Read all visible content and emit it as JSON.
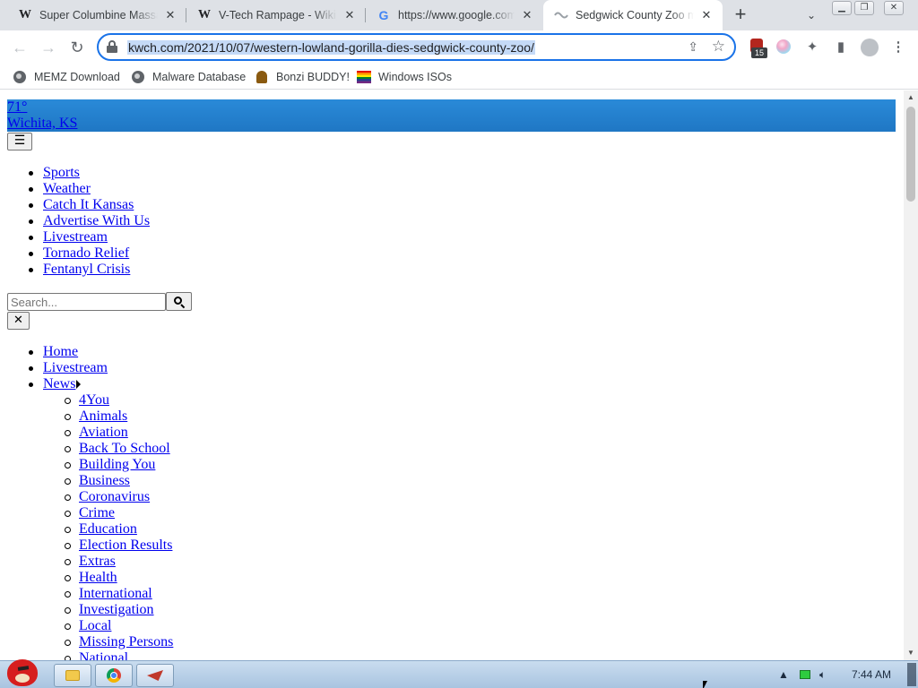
{
  "tabs": [
    {
      "favicon": "W",
      "title": "Super Columbine Massacre RPG!"
    },
    {
      "favicon": "W",
      "title": "V-Tech Rampage - Wikipedia"
    },
    {
      "favicon": "G",
      "title": "https://www.google.com"
    },
    {
      "favicon": "zoo",
      "title": "Sedgwick County Zoo mourns"
    }
  ],
  "omnibox": {
    "url": "kwch.com/2021/10/07/western-lowland-gorilla-dies-sedgwick-county-zoo/"
  },
  "extensions": {
    "badge_count": "15"
  },
  "bookmarks": [
    {
      "label": "MEMZ Download",
      "icon": "globe-icon"
    },
    {
      "label": "Malware Database",
      "icon": "globe-icon"
    },
    {
      "label": "Bonzi BUDDY!",
      "icon": "bonzi-icon"
    },
    {
      "label": "Windows ISOs",
      "icon": "windows-icon"
    }
  ],
  "weather": {
    "temp": "71°",
    "location": "Wichita, KS"
  },
  "menu_button": "☰",
  "top_nav": [
    "Sports",
    "Weather",
    "Catch It Kansas",
    "Advertise With Us",
    "Livestream",
    "Tornado Relief",
    "Fentanyl Crisis"
  ],
  "search": {
    "placeholder": "Search..."
  },
  "close_button": "✕",
  "main_nav": [
    "Home",
    "Livestream",
    "News"
  ],
  "news_sub": [
    "4You",
    "Animals",
    "Aviation",
    "Back To School",
    "Building You",
    "Business",
    "Coronavirus",
    "Crime",
    "Education",
    "Election Results",
    "Extras",
    "Health",
    "International",
    "Investigation",
    "Local",
    "Missing Persons",
    "National"
  ],
  "taskbar": {
    "clock": "7:44 AM"
  },
  "colors": {
    "accent": "#1a73e8",
    "weather_bar": "#2481cf",
    "link": "#0000ee",
    "taskbar": "#b9d0e8"
  }
}
